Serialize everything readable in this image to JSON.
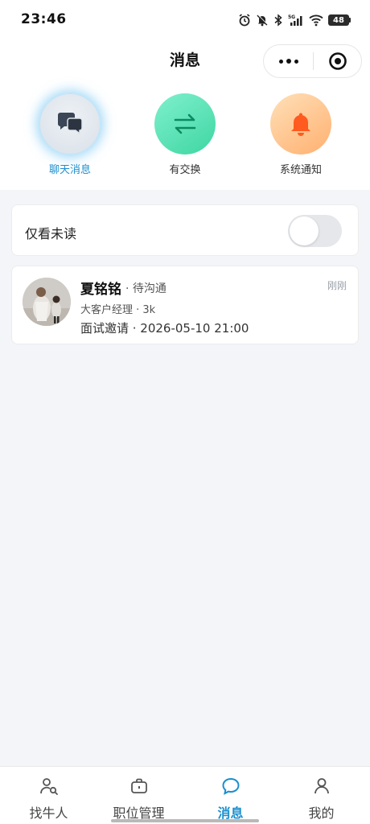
{
  "status_bar": {
    "time": "23:46",
    "network": "5G",
    "battery": "48",
    "icons": [
      "alarm-icon",
      "mute-bell-icon",
      "bluetooth-icon",
      "signal-icon",
      "wifi-icon",
      "battery-icon"
    ]
  },
  "header": {
    "title": "消息",
    "more_icon": "more-dots-icon",
    "close_icon": "target-circle-icon"
  },
  "categories": [
    {
      "label": "聊天消息",
      "icon": "chat-bubbles-icon",
      "active": true
    },
    {
      "label": "有交换",
      "icon": "swap-arrows-icon",
      "active": false
    },
    {
      "label": "系统通知",
      "icon": "bell-icon",
      "active": false
    }
  ],
  "filter": {
    "label": "仅看未读",
    "toggle_on": false
  },
  "messages": [
    {
      "name": "夏铭铭",
      "status": "· 待沟通",
      "time": "刚刚",
      "subtitle": "大客户经理 · 3k",
      "preview": "面试邀请 · 2026-05-10 21:00"
    }
  ],
  "tabbar": [
    {
      "label": "找牛人",
      "icon": "person-search-icon",
      "active": false
    },
    {
      "label": "职位管理",
      "icon": "briefcase-icon",
      "active": false
    },
    {
      "label": "消息",
      "icon": "chat-bubble-icon",
      "active": true
    },
    {
      "label": "我的",
      "icon": "profile-icon",
      "active": false
    }
  ],
  "colors": {
    "accent": "#1a8fcf",
    "background": "#f3f5f9",
    "exchange_green": "#3fd6a3",
    "bell_orange": "#ff5a1f"
  }
}
